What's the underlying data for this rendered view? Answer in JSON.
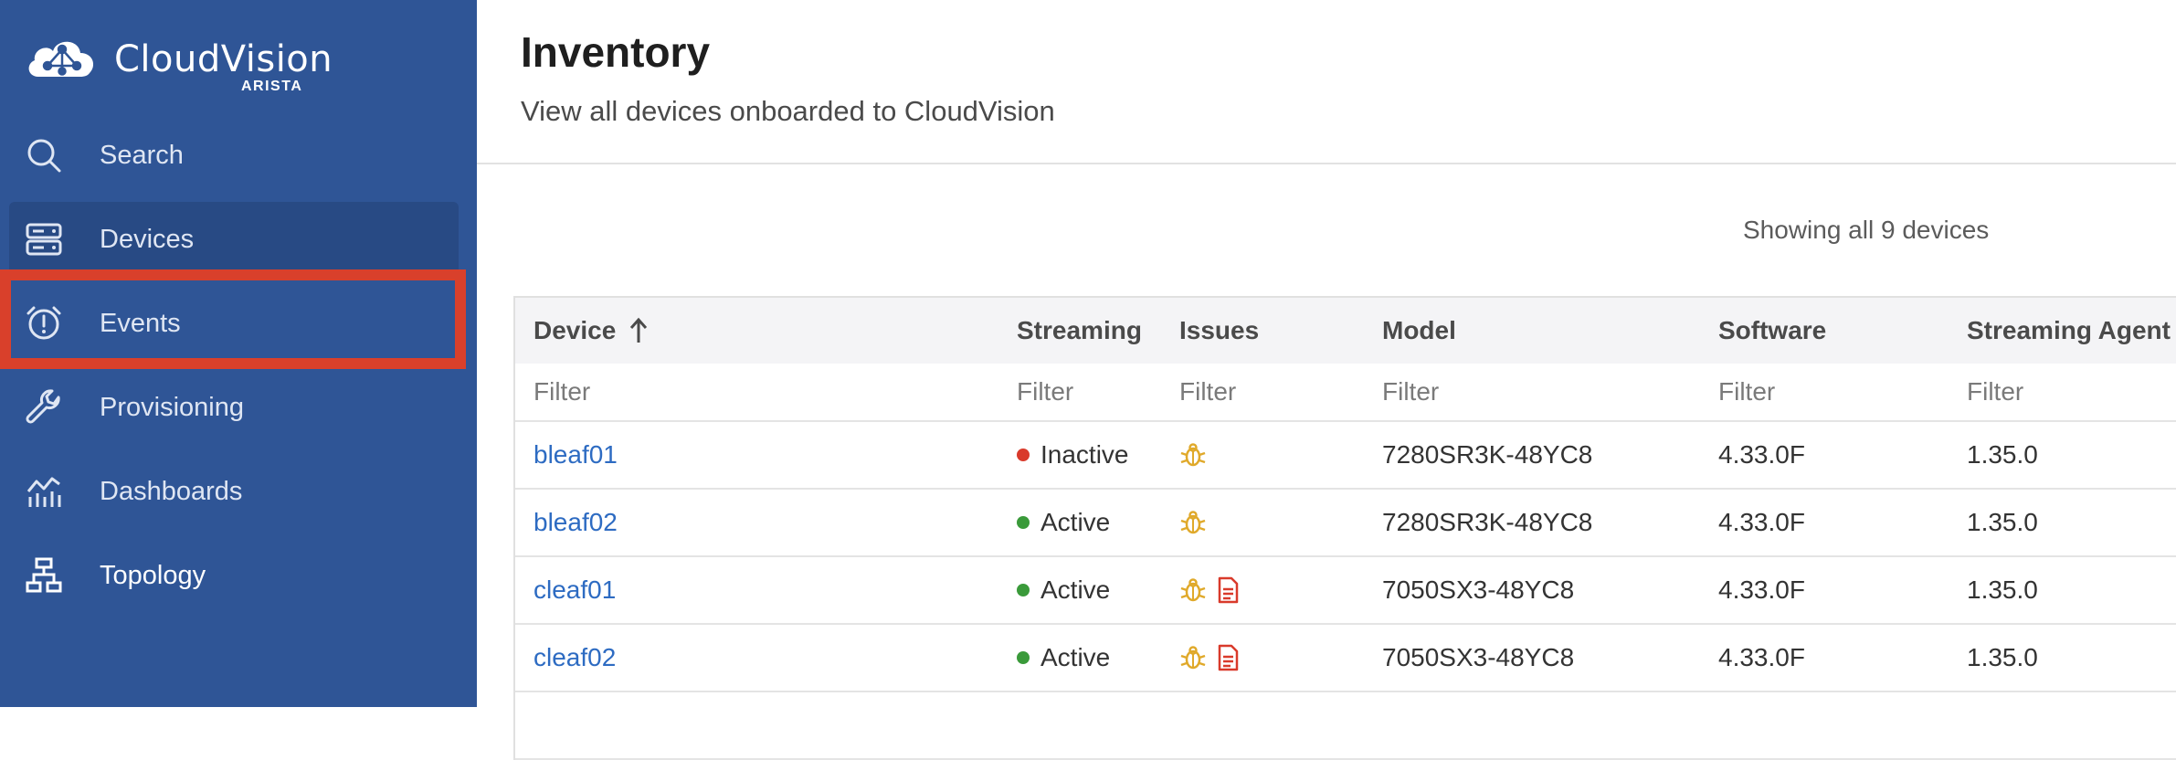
{
  "brand": {
    "name": "CloudVision",
    "sub": "ARISTA",
    "logo_icon": "cloud-network-icon"
  },
  "sidebar": {
    "items": [
      {
        "label": "Search",
        "icon": "search-icon"
      },
      {
        "label": "Devices",
        "icon": "server-icon"
      },
      {
        "label": "Events",
        "icon": "alarm-clock-icon"
      },
      {
        "label": "Provisioning",
        "icon": "wrench-icon"
      },
      {
        "label": "Dashboards",
        "icon": "chart-icon"
      },
      {
        "label": "Topology",
        "icon": "topology-icon"
      }
    ]
  },
  "page": {
    "title": "Inventory",
    "subtitle": "View all devices onboarded to CloudVision",
    "showing": "Showing all 9 devices"
  },
  "table": {
    "columns": [
      "Device",
      "Streaming",
      "Issues",
      "Model",
      "Software",
      "Streaming Agent"
    ],
    "filter_placeholder": "Filter",
    "rows": [
      {
        "device": "bleaf01",
        "streaming": "Inactive",
        "model": "7280SR3K-48YC8",
        "software": "4.33.0F",
        "agent": "1.35.0"
      },
      {
        "device": "bleaf02",
        "streaming": "Active",
        "model": "7280SR3K-48YC8",
        "software": "4.33.0F",
        "agent": "1.35.0"
      },
      {
        "device": "cleaf01",
        "streaming": "Active",
        "model": "7050SX3-48YC8",
        "software": "4.33.0F",
        "agent": "1.35.0"
      },
      {
        "device": "cleaf02",
        "streaming": "Active",
        "model": "7050SX3-48YC8",
        "software": "4.33.0F",
        "agent": "1.35.0"
      }
    ]
  },
  "colors": {
    "sidebar_bg": "#2f5596",
    "highlight": "#d9402b",
    "link": "#2d6bc2",
    "status_active": "#3a9a3a",
    "status_inactive": "#d93a2b",
    "bug_icon": "#e0a92a",
    "doc_icon": "#d93a2b"
  }
}
